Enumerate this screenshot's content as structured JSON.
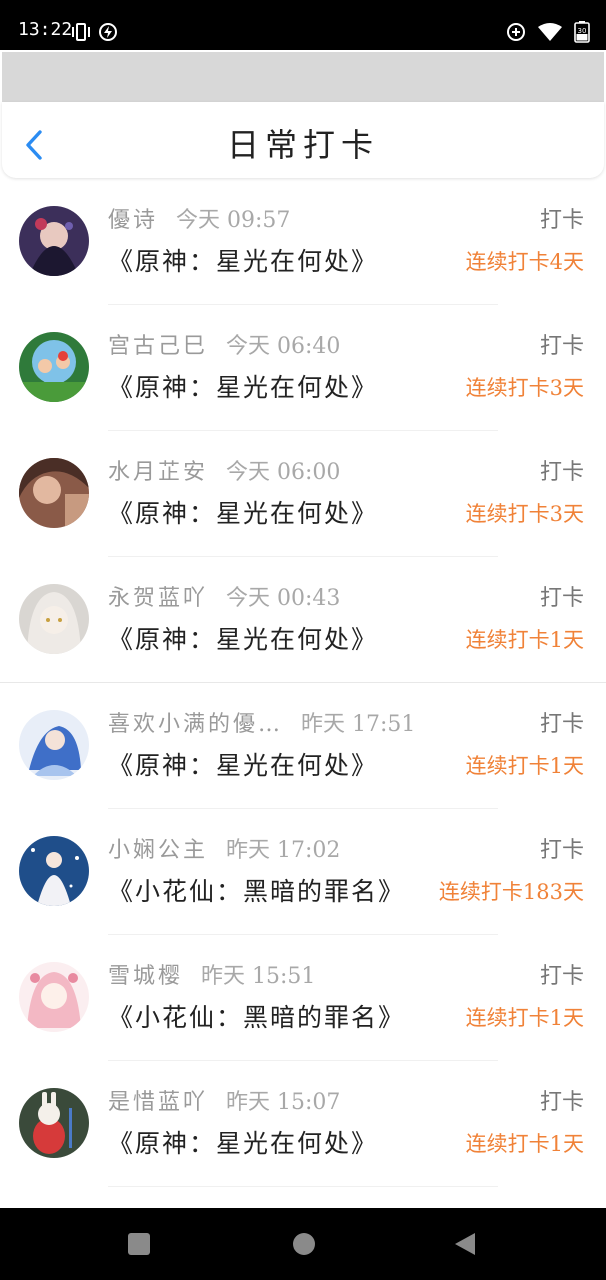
{
  "status_bar": {
    "time": "13:22",
    "battery": "30",
    "icons": [
      "vibrate-icon",
      "charging-icon",
      "data-saver-icon",
      "wifi-icon",
      "battery-icon"
    ]
  },
  "header": {
    "title": "日常打卡",
    "back_icon": "chevron-left-icon",
    "accent": "#2b8cf2"
  },
  "colors": {
    "streak": "#f08238",
    "name": "#9a9a9a",
    "book": "#222222"
  },
  "entries": [
    {
      "name": "優诗",
      "time": "今天 09:57",
      "book": "《原神：星光在何处》",
      "action": "打卡",
      "streak": "连续打卡4天"
    },
    {
      "name": "宫古己巳",
      "time": "今天 06:40",
      "book": "《原神：星光在何处》",
      "action": "打卡",
      "streak": "连续打卡3天"
    },
    {
      "name": "水月芷安",
      "time": "今天 06:00",
      "book": "《原神：星光在何处》",
      "action": "打卡",
      "streak": "连续打卡3天"
    },
    {
      "name": "永贺蓝吖",
      "time": "今天 00:43",
      "book": "《原神：星光在何处》",
      "action": "打卡",
      "streak": "连续打卡1天"
    },
    {
      "name": "喜欢小满的優…",
      "time": "昨天 17:51",
      "book": "《原神：星光在何处》",
      "action": "打卡",
      "streak": "连续打卡1天"
    },
    {
      "name": "小娴公主",
      "time": "昨天 17:02",
      "book": "《小花仙：黑暗的罪名》",
      "action": "打卡",
      "streak": "连续打卡183天"
    },
    {
      "name": "雪城樱",
      "time": "昨天 15:51",
      "book": "《小花仙：黑暗的罪名》",
      "action": "打卡",
      "streak": "连续打卡1天"
    },
    {
      "name": "是惜蓝吖",
      "time": "昨天 15:07",
      "book": "《原神：星光在何处》",
      "action": "打卡",
      "streak": "连续打卡1天"
    }
  ],
  "nav_bar": {
    "icons": [
      "recents-square-icon",
      "home-circle-icon",
      "back-triangle-icon"
    ]
  }
}
